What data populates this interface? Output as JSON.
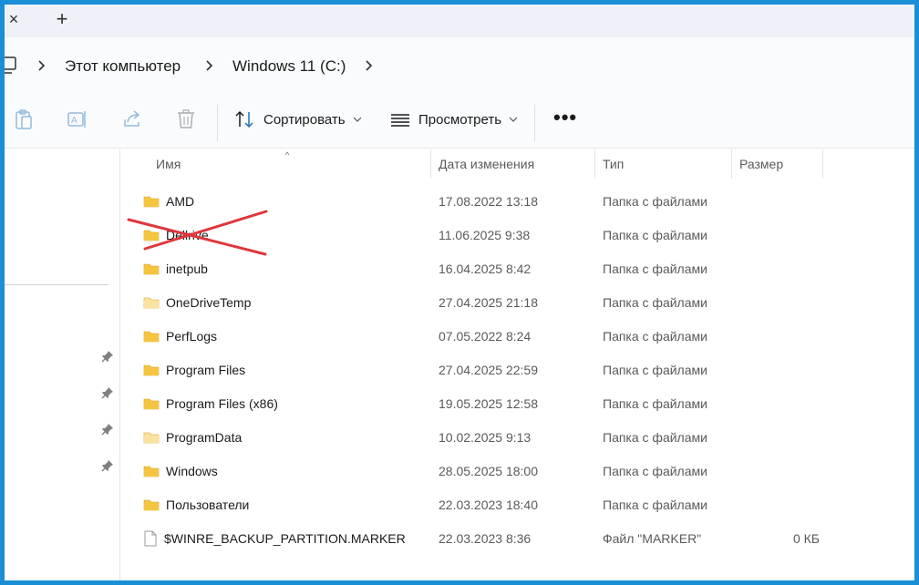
{
  "tabbar": {
    "close_glyph": "×",
    "add_glyph": "+"
  },
  "breadcrumb": {
    "items": [
      "Этот компьютер",
      "Windows 11 (C:)"
    ]
  },
  "toolbar": {
    "sort_label": "Сортировать",
    "view_label": "Просмотреть",
    "more_glyph": "•••"
  },
  "columns": {
    "name": "Имя",
    "date": "Дата изменения",
    "type": "Тип",
    "size": "Размер"
  },
  "files": [
    {
      "name": "AMD",
      "date": "17.08.2022 13:18",
      "type": "Папка с файлами",
      "size": "",
      "icon": "folder-icon"
    },
    {
      "name": "Dellrive",
      "date": "11.06.2025 9:38",
      "type": "Папка с файлами",
      "size": "",
      "icon": "folder-icon"
    },
    {
      "name": "inetpub",
      "date": "16.04.2025 8:42",
      "type": "Папка с файлами",
      "size": "",
      "icon": "folder-icon"
    },
    {
      "name": "OneDriveTemp",
      "date": "27.04.2025 21:18",
      "type": "Папка с файлами",
      "size": "",
      "icon": "folder-light-icon"
    },
    {
      "name": "PerfLogs",
      "date": "07.05.2022 8:24",
      "type": "Папка с файлами",
      "size": "",
      "icon": "folder-icon"
    },
    {
      "name": "Program Files",
      "date": "27.04.2025 22:59",
      "type": "Папка с файлами",
      "size": "",
      "icon": "folder-icon"
    },
    {
      "name": "Program Files (x86)",
      "date": "19.05.2025 12:58",
      "type": "Папка с файлами",
      "size": "",
      "icon": "folder-icon"
    },
    {
      "name": "ProgramData",
      "date": "10.02.2025 9:13",
      "type": "Папка с файлами",
      "size": "",
      "icon": "folder-light-icon"
    },
    {
      "name": "Windows",
      "date": "28.05.2025 18:00",
      "type": "Папка с файлами",
      "size": "",
      "icon": "folder-icon"
    },
    {
      "name": "Пользователи",
      "date": "22.03.2023 18:40",
      "type": "Папка с файлами",
      "size": "",
      "icon": "folder-icon"
    },
    {
      "name": "$WINRE_BACKUP_PARTITION.MARKER",
      "date": "22.03.2023 8:36",
      "type": "Файл \"MARKER\"",
      "size": "0 КБ",
      "icon": "file-icon"
    }
  ],
  "colors": {
    "accent_border": "#1a8fd6",
    "folder": "#f5c542",
    "folder_light": "#fbe2a0",
    "cross": "#e0363d"
  }
}
